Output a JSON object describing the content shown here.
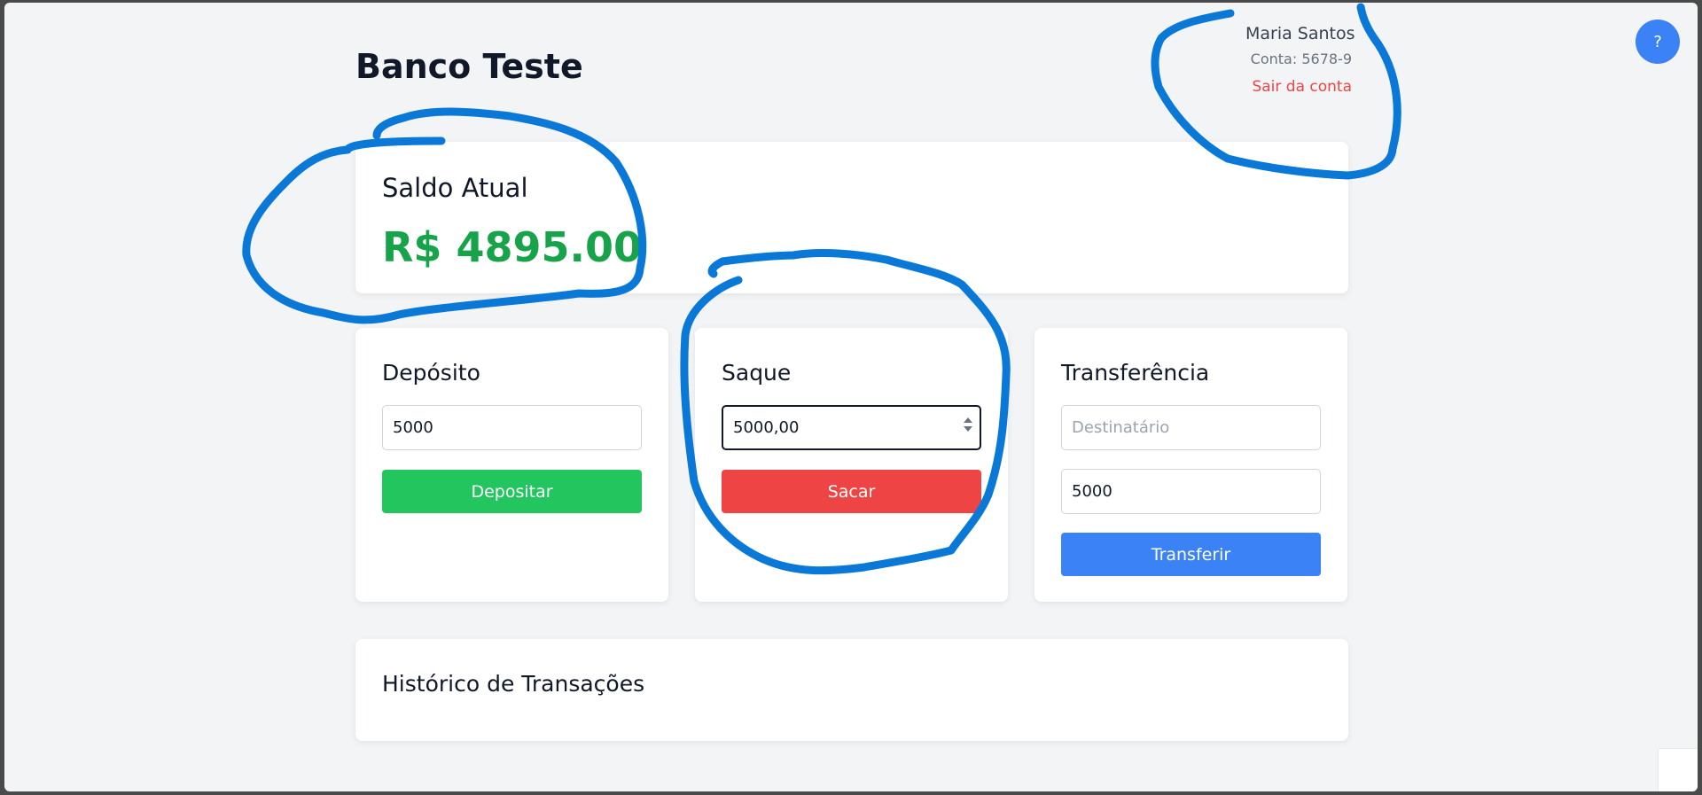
{
  "header": {
    "title": "Banco Teste",
    "help_label": "?"
  },
  "user": {
    "name": "Maria Santos",
    "account": "Conta: 5678-9",
    "logout_label": "Sair da conta"
  },
  "balance": {
    "title": "Saldo Atual",
    "value": "R$ 4895.00",
    "color": "#16a34a"
  },
  "deposit": {
    "title": "Depósito",
    "amount_value": "5000",
    "button_label": "Depositar",
    "button_color": "#22c55e"
  },
  "withdraw": {
    "title": "Saque",
    "amount_value": "5000,00",
    "button_label": "Sacar",
    "button_color": "#ef4444"
  },
  "transfer": {
    "title": "Transferência",
    "recipient_placeholder": "Destinatário",
    "amount_value": "5000",
    "button_label": "Transferir",
    "button_color": "#3b82f6"
  },
  "history": {
    "title": "Histórico de Transações"
  },
  "annotation_color": "#0a78d7"
}
